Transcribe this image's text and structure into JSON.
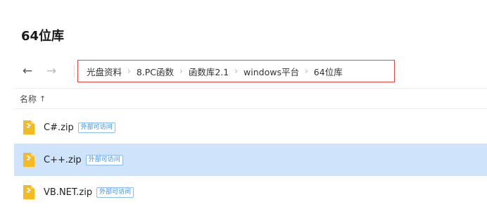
{
  "page": {
    "title": "64位库"
  },
  "nav": {
    "back": "←",
    "forward": "→"
  },
  "breadcrumb": {
    "items": [
      "光盘资料",
      "8.PC函数",
      "函数库2.1",
      "windows平台",
      "64位库"
    ],
    "separator": "›"
  },
  "columns": {
    "name_label": "名称",
    "sort_arrow": "↑"
  },
  "files": [
    {
      "name": "C#.zip",
      "badge": "外部可访问",
      "selected": false,
      "icon": "zip-file-icon"
    },
    {
      "name": "C++.zip",
      "badge": "外部可访问",
      "selected": true,
      "icon": "zip-file-icon"
    },
    {
      "name": "VB.NET.zip",
      "badge": "外部可访问",
      "selected": false,
      "icon": "zip-file-icon"
    }
  ],
  "colors": {
    "selection": "#cfe3fa",
    "highlight_border": "#e24a4a",
    "badge": "#3a8de0",
    "zip_icon": "#f5b922"
  }
}
